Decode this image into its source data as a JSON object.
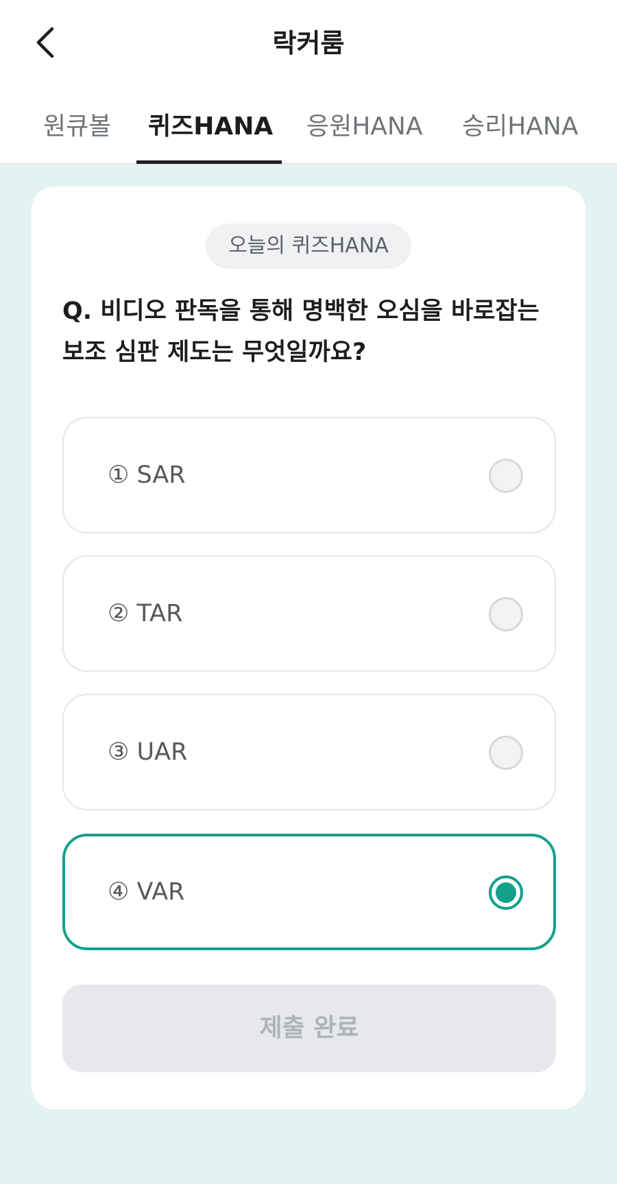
{
  "header": {
    "title": "락커룸",
    "back_icon": "chevron-left-icon"
  },
  "tabs": [
    {
      "label": "원큐볼",
      "active": false
    },
    {
      "label": "퀴즈HANA",
      "active": true
    },
    {
      "label": "응원HANA",
      "active": false
    },
    {
      "label": "승리HANA",
      "active": false
    }
  ],
  "quiz": {
    "badge": "오늘의 퀴즈HANA",
    "question_line1": "Q. 비디오 판독을 통해 명백한 오심을 바로잡는",
    "question_line2": "보조 심판 제도는 무엇일까요?",
    "options": [
      {
        "label": "① SAR",
        "selected": false
      },
      {
        "label": "② TAR",
        "selected": false
      },
      {
        "label": "③ UAR",
        "selected": false
      },
      {
        "label": "④ VAR",
        "selected": true
      }
    ],
    "submit_label": "제출 완료"
  },
  "colors": {
    "accent": "#13a08c",
    "background": "#e4f3f2",
    "card": "#ffffff",
    "disabled_button": "#e6e8eb"
  }
}
